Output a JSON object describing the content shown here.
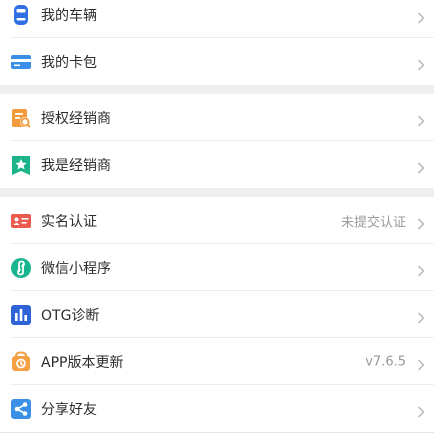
{
  "colors": {
    "car": "#2f6fe4",
    "card": "#3a8fe6",
    "authorize": "#f39a3c",
    "dealer": "#1bb38a",
    "realname": "#ea5a4f",
    "miniprogram": "#19b590",
    "otg": "#2f64d8",
    "update": "#f4a043",
    "share": "#3a8fe6",
    "chevron": "#b5b5b5"
  },
  "group1": {
    "items": [
      {
        "label": "我的车辆",
        "icon": "car-icon"
      },
      {
        "label": "我的卡包",
        "icon": "card-icon"
      }
    ]
  },
  "group2": {
    "items": [
      {
        "label": "授权经销商",
        "icon": "authorize-dealer-icon"
      },
      {
        "label": "我是经销商",
        "icon": "dealer-star-icon"
      }
    ]
  },
  "group3": {
    "items": [
      {
        "label": "实名认证",
        "value": "未提交认证",
        "icon": "id-card-icon"
      },
      {
        "label": "微信小程序",
        "icon": "mini-program-icon"
      },
      {
        "label": "OTG诊断",
        "icon": "otg-chart-icon"
      },
      {
        "label": "APP版本更新",
        "value": "v7.6.5",
        "icon": "update-icon"
      },
      {
        "label": "分享好友",
        "icon": "share-icon"
      }
    ]
  }
}
